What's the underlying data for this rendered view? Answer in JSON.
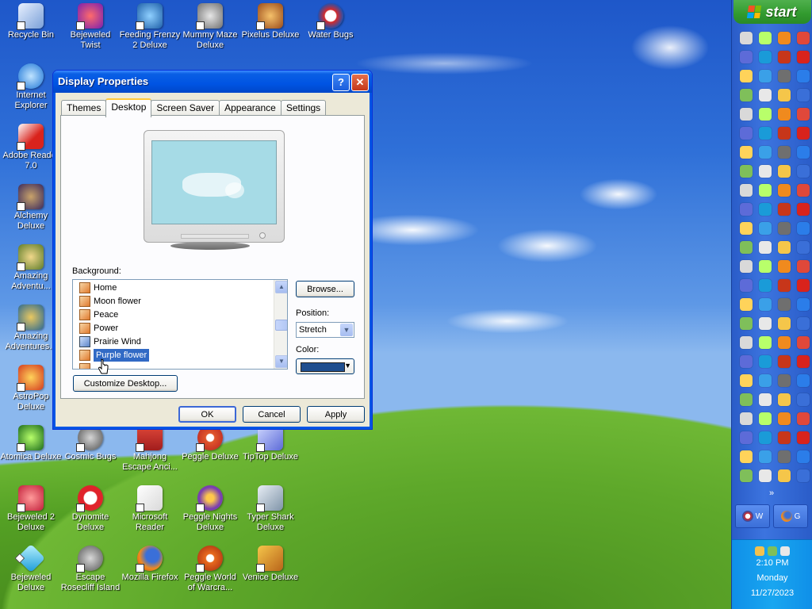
{
  "desktop": {
    "icons": [
      {
        "label": "Recycle Bin"
      },
      {
        "label": "Bejeweled Twist"
      },
      {
        "label": "Feeding Frenzy 2 Deluxe"
      },
      {
        "label": "Mummy Maze Deluxe"
      },
      {
        "label": "Pixelus Deluxe"
      },
      {
        "label": "Water Bugs"
      },
      {
        "label": "Internet Explorer"
      },
      {
        "label": "Adobe Reader 7.0"
      },
      {
        "label": "Alchemy Deluxe"
      },
      {
        "label": "Amazing Adventu..."
      },
      {
        "label": "Amazing Adventures..."
      },
      {
        "label": "AstroPop Deluxe"
      },
      {
        "label": "Atomica Deluxe"
      },
      {
        "label": "Cosmic Bugs"
      },
      {
        "label": "Mahjong Escape Anci..."
      },
      {
        "label": "Peggle Deluxe"
      },
      {
        "label": "TipTop Deluxe"
      },
      {
        "label": "Bejeweled 2 Deluxe"
      },
      {
        "label": "Dynomite Deluxe"
      },
      {
        "label": "Microsoft Reader"
      },
      {
        "label": "Peggle Nights Deluxe"
      },
      {
        "label": "Typer Shark Deluxe"
      },
      {
        "label": "Bejeweled Deluxe"
      },
      {
        "label": "Escape Rosecliff Island"
      },
      {
        "label": "Mozilla Firefox"
      },
      {
        "label": "Peggle World of Warcra..."
      },
      {
        "label": "Venice Deluxe"
      }
    ]
  },
  "dialog": {
    "title": "Display Properties",
    "help_glyph": "?",
    "close_glyph": "✕",
    "tabs": [
      {
        "label": "Themes",
        "active": false
      },
      {
        "label": "Desktop",
        "active": true
      },
      {
        "label": "Screen Saver",
        "active": false
      },
      {
        "label": "Appearance",
        "active": false
      },
      {
        "label": "Settings",
        "active": false
      }
    ],
    "background_label": "Background:",
    "background_items": [
      {
        "label": "Home",
        "selected": false
      },
      {
        "label": "Moon flower",
        "selected": false
      },
      {
        "label": "Peace",
        "selected": false
      },
      {
        "label": "Power",
        "selected": false
      },
      {
        "label": "Prairie Wind",
        "selected": false
      },
      {
        "label": "Purple flower",
        "selected": true
      }
    ],
    "browse_label": "Browse...",
    "position_label": "Position:",
    "position_value": "Stretch",
    "color_label": "Color:",
    "color_value": "#1f4e8f",
    "customize_label": "Customize Desktop...",
    "ok_label": "OK",
    "cancel_label": "Cancel",
    "apply_label": "Apply"
  },
  "taskbar": {
    "start_label": "start",
    "more_glyph": "»",
    "task_buttons": [
      {
        "label": "W"
      },
      {
        "label": "G"
      }
    ],
    "clock": {
      "time": "2:10 PM",
      "day": "Monday",
      "date": "11/27/2023"
    }
  },
  "colors": {
    "xp_blue": "#0054e3",
    "start_green": "#319a2e",
    "selection": "#316ac5"
  }
}
